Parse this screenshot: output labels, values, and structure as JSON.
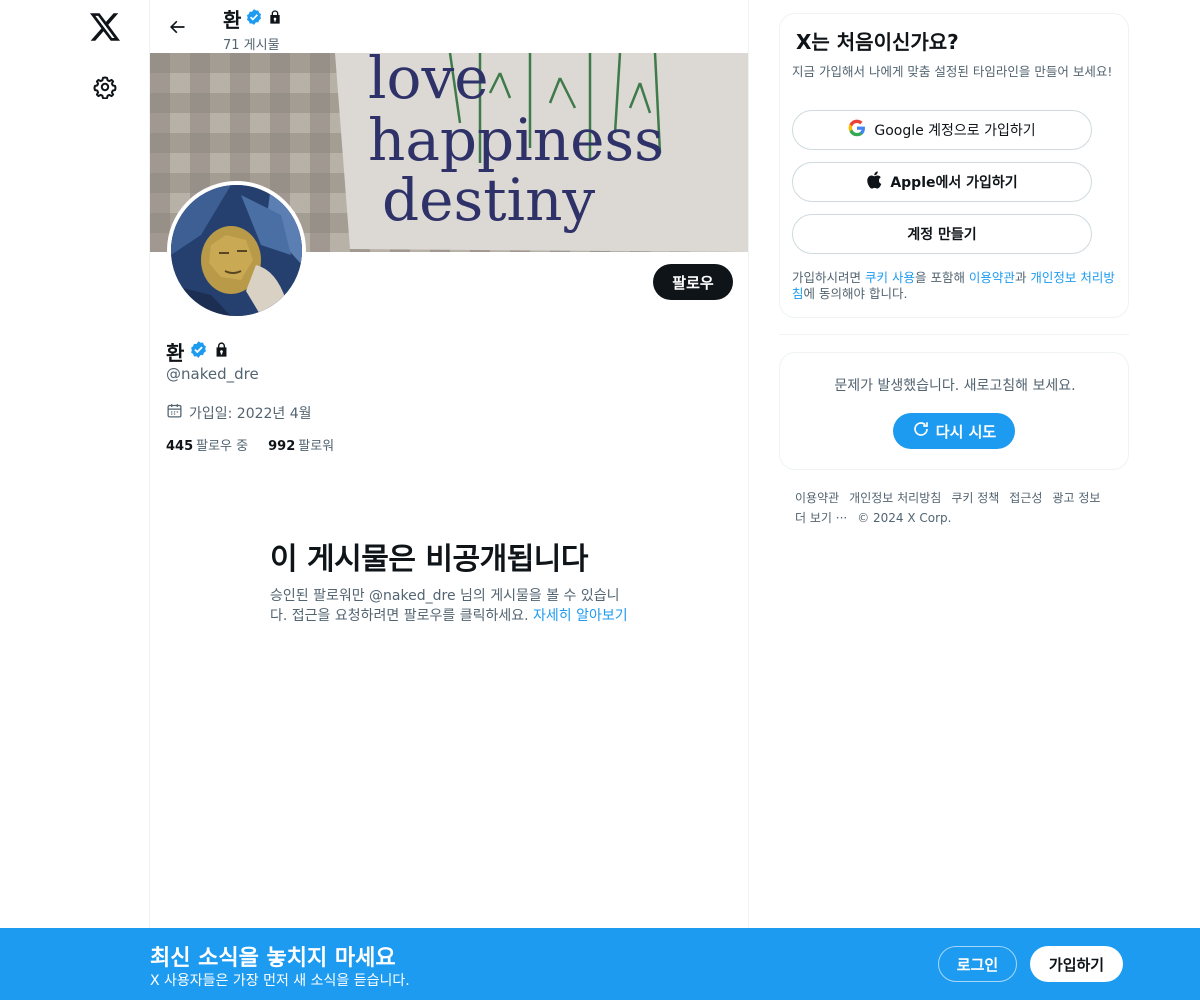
{
  "nav": {
    "logo_icon": "x-logo-icon",
    "settings_icon": "gear-icon"
  },
  "topbar": {
    "name": "환",
    "posts_count": "71 게시물"
  },
  "banner": {
    "text_lines": [
      "love",
      "happiness",
      "destiny"
    ]
  },
  "profile": {
    "name": "환",
    "handle": "@naked_dre",
    "joined": "가입일: 2022년 4월",
    "following_count": "445",
    "following_label": "팔로우 중",
    "followers_count": "992",
    "followers_label": "팔로워",
    "follow_button": "팔로우"
  },
  "private_notice": {
    "title": "이 게시물은 비공개됩니다",
    "body": "승인된 팔로워만 @naked_dre 님의 게시물을 볼 수 있습니다. 접근을 요청하려면 팔로우를 클릭하세요. ",
    "link": "자세히 알아보기"
  },
  "signup_card": {
    "title": "X는 처음이신가요?",
    "description": "지금 가입해서 나에게 맞춤 설정된 타임라인을 만들어 보세요!",
    "google_button": "Google 계정으로 가입하기",
    "apple_button": "Apple에서 가입하기",
    "create_button": "계정 만들기",
    "legal_prefix": "가입하시려면 ",
    "legal_cookie": "쿠키 사용",
    "legal_mid1": "을 포함해 ",
    "legal_terms": "이용약관",
    "legal_mid2": "과 ",
    "legal_privacy": "개인정보 처리방침",
    "legal_suffix": "에 동의해야 합니다."
  },
  "error_card": {
    "message": "문제가 발생했습니다. 새로고침해 보세요.",
    "retry_button": "다시 시도"
  },
  "footer": {
    "links": [
      "이용약관",
      "개인정보 처리방침",
      "쿠키 정책",
      "접근성",
      "광고 정보",
      "더 보기 ···"
    ],
    "copyright": "© 2024 X Corp."
  },
  "bottom_bar": {
    "title": "최신 소식을 놓치지 마세요",
    "subtitle": "X 사용자들은 가장 먼저 새 소식을 듣습니다.",
    "login_button": "로그인",
    "signup_button": "가입하기"
  },
  "colors": {
    "accent": "#1d9bf0",
    "text": "#0f1419",
    "muted": "#536471",
    "border": "#eff3f4"
  }
}
